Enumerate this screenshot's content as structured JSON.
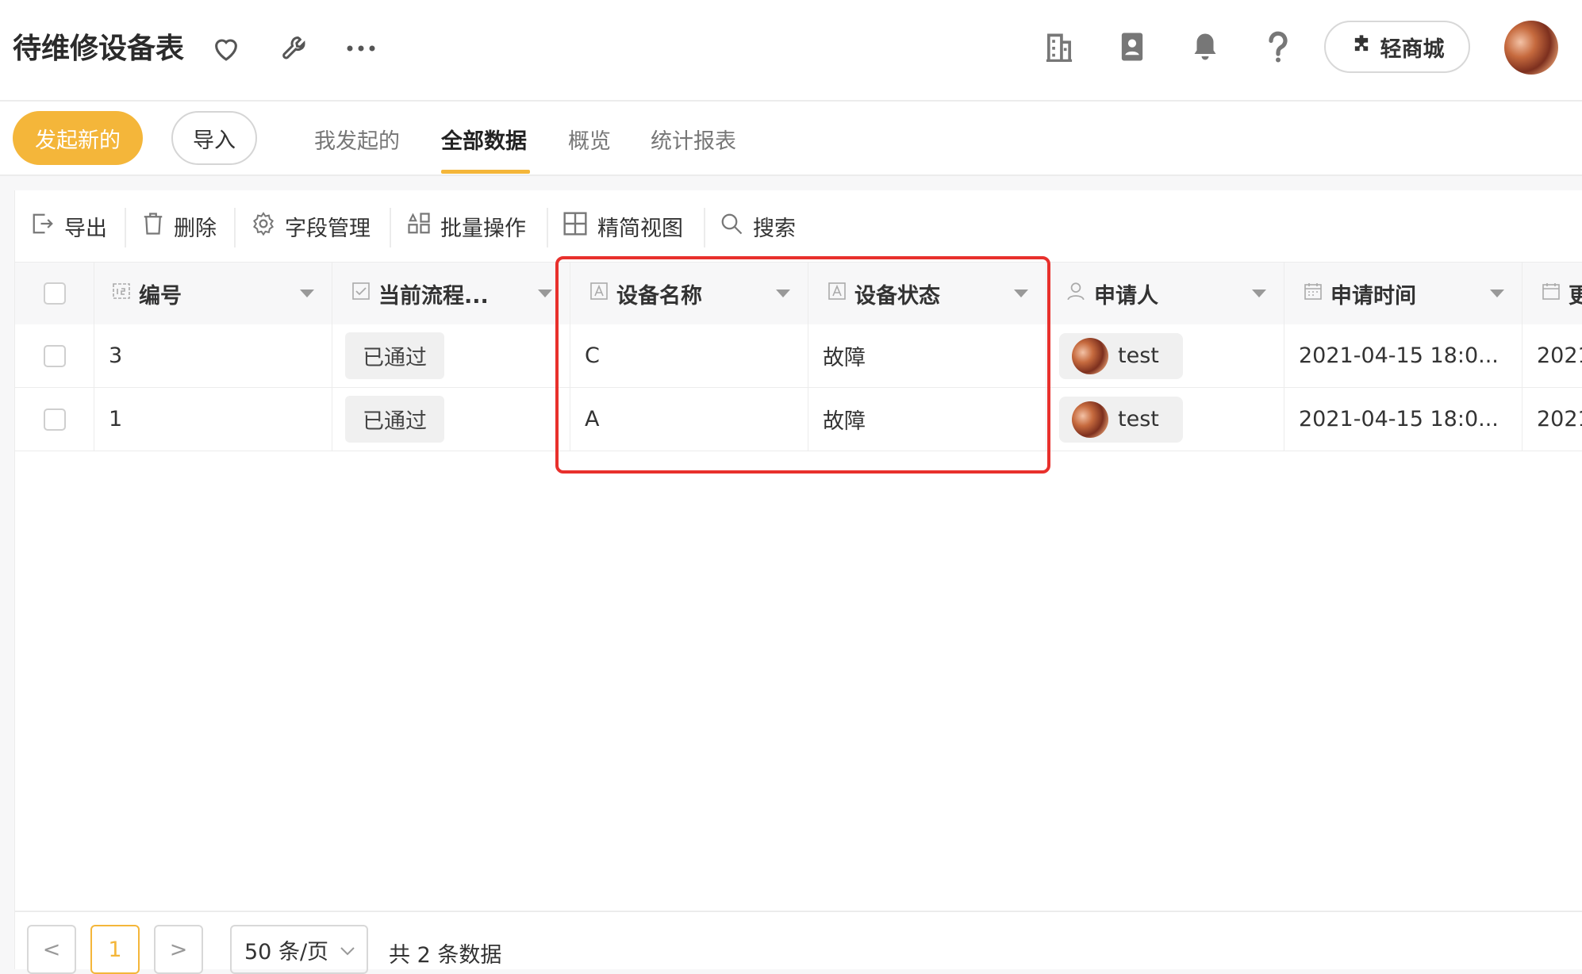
{
  "app": {
    "title": "待维修设备表"
  },
  "header": {
    "mall_label": "轻商城"
  },
  "icons": {
    "favorite": "heart-icon",
    "tools": "wrench-icon",
    "more": "more-icon",
    "org": "building-icon",
    "contacts": "contacts-icon",
    "notify": "bell-icon",
    "help": "help-icon",
    "plugin": "puzzle-icon"
  },
  "actions": {
    "new_label": "发起新的",
    "import_label": "导入"
  },
  "tabs": [
    "我发起的",
    "全部数据",
    "概览",
    "统计报表"
  ],
  "active_tab": "全部数据",
  "toolbar": {
    "export": "导出",
    "delete": "删除",
    "fields": "字段管理",
    "batch": "批量操作",
    "compact": "精简视图",
    "search": "搜索"
  },
  "columns": {
    "id": "编号",
    "flow": "当前流程...",
    "name": "设备名称",
    "status": "设备状态",
    "applicant": "申请人",
    "time": "申请时间",
    "extra": "更"
  },
  "rows": [
    {
      "id": "3",
      "flow": "已通过",
      "name": "C",
      "status": "故障",
      "applicant": "test",
      "time": "2021-04-15 18:0...",
      "extra": "2021"
    },
    {
      "id": "1",
      "flow": "已通过",
      "name": "A",
      "status": "故障",
      "applicant": "test",
      "time": "2021-04-15 18:0...",
      "extra": "2021"
    }
  ],
  "pagination": {
    "prev": "<",
    "current": "1",
    "next": ">",
    "page_size": "50 条/页",
    "total": "共 2 条数据"
  },
  "colors": {
    "accent": "#f4b63a",
    "highlight": "#e8302c"
  }
}
